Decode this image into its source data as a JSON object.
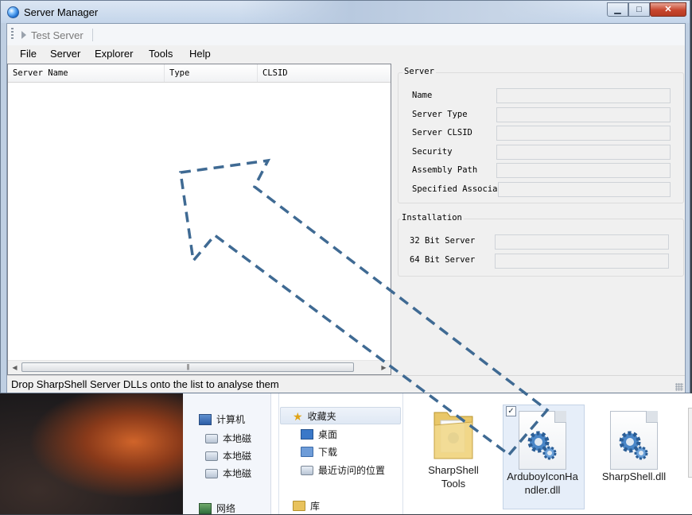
{
  "window": {
    "title": "Server Manager"
  },
  "toolbar": {
    "test_server_label": "Test Server"
  },
  "menu": [
    "File",
    "Server",
    "Explorer",
    "Tools",
    "Help"
  ],
  "server_list": {
    "columns": [
      "Server Name",
      "Type",
      "CLSID"
    ],
    "rows": []
  },
  "server_group": {
    "title": "Server",
    "fields": [
      {
        "label": "Name",
        "value": ""
      },
      {
        "label": "Server Type",
        "value": ""
      },
      {
        "label": "Server CLSID",
        "value": ""
      },
      {
        "label": "Security",
        "value": ""
      },
      {
        "label": "Assembly Path",
        "value": ""
      },
      {
        "label": "Specified Associat",
        "value": ""
      }
    ]
  },
  "installation_group": {
    "title": "Installation",
    "fields": [
      {
        "label": "32 Bit Server",
        "value": ""
      },
      {
        "label": "64 Bit Server",
        "value": ""
      }
    ]
  },
  "status": {
    "text": "Drop SharpShell Server DLLs onto the list to analyse them"
  },
  "explorer": {
    "nav": {
      "computer": "计算机",
      "drive1": "本地磁",
      "drive2": "本地磁",
      "drive3": "本地磁",
      "network": "网络"
    },
    "favorites": {
      "header": "收藏夹",
      "desktop": "桌面",
      "downloads": "下载",
      "recent": "最近访问的位置",
      "libraries": "库"
    },
    "files": [
      {
        "name": "SharpShell Tools",
        "line1": "SharpShell",
        "line2": "Tools",
        "icon": "folder-icon"
      },
      {
        "name": "ArduboyIconHandler.dll",
        "line1": "ArduboyIconHa",
        "line2": "ndler.dll",
        "icon": "dll-gear-icon"
      },
      {
        "name": "SharpShell.dll",
        "line1": "SharpShell.dll",
        "line2": "",
        "icon": "dll-gear-icon"
      }
    ]
  },
  "colors": {
    "drag_arrow": "#3f6a93",
    "titlebar": "#c4d5ea",
    "close_button": "#c7452d"
  }
}
